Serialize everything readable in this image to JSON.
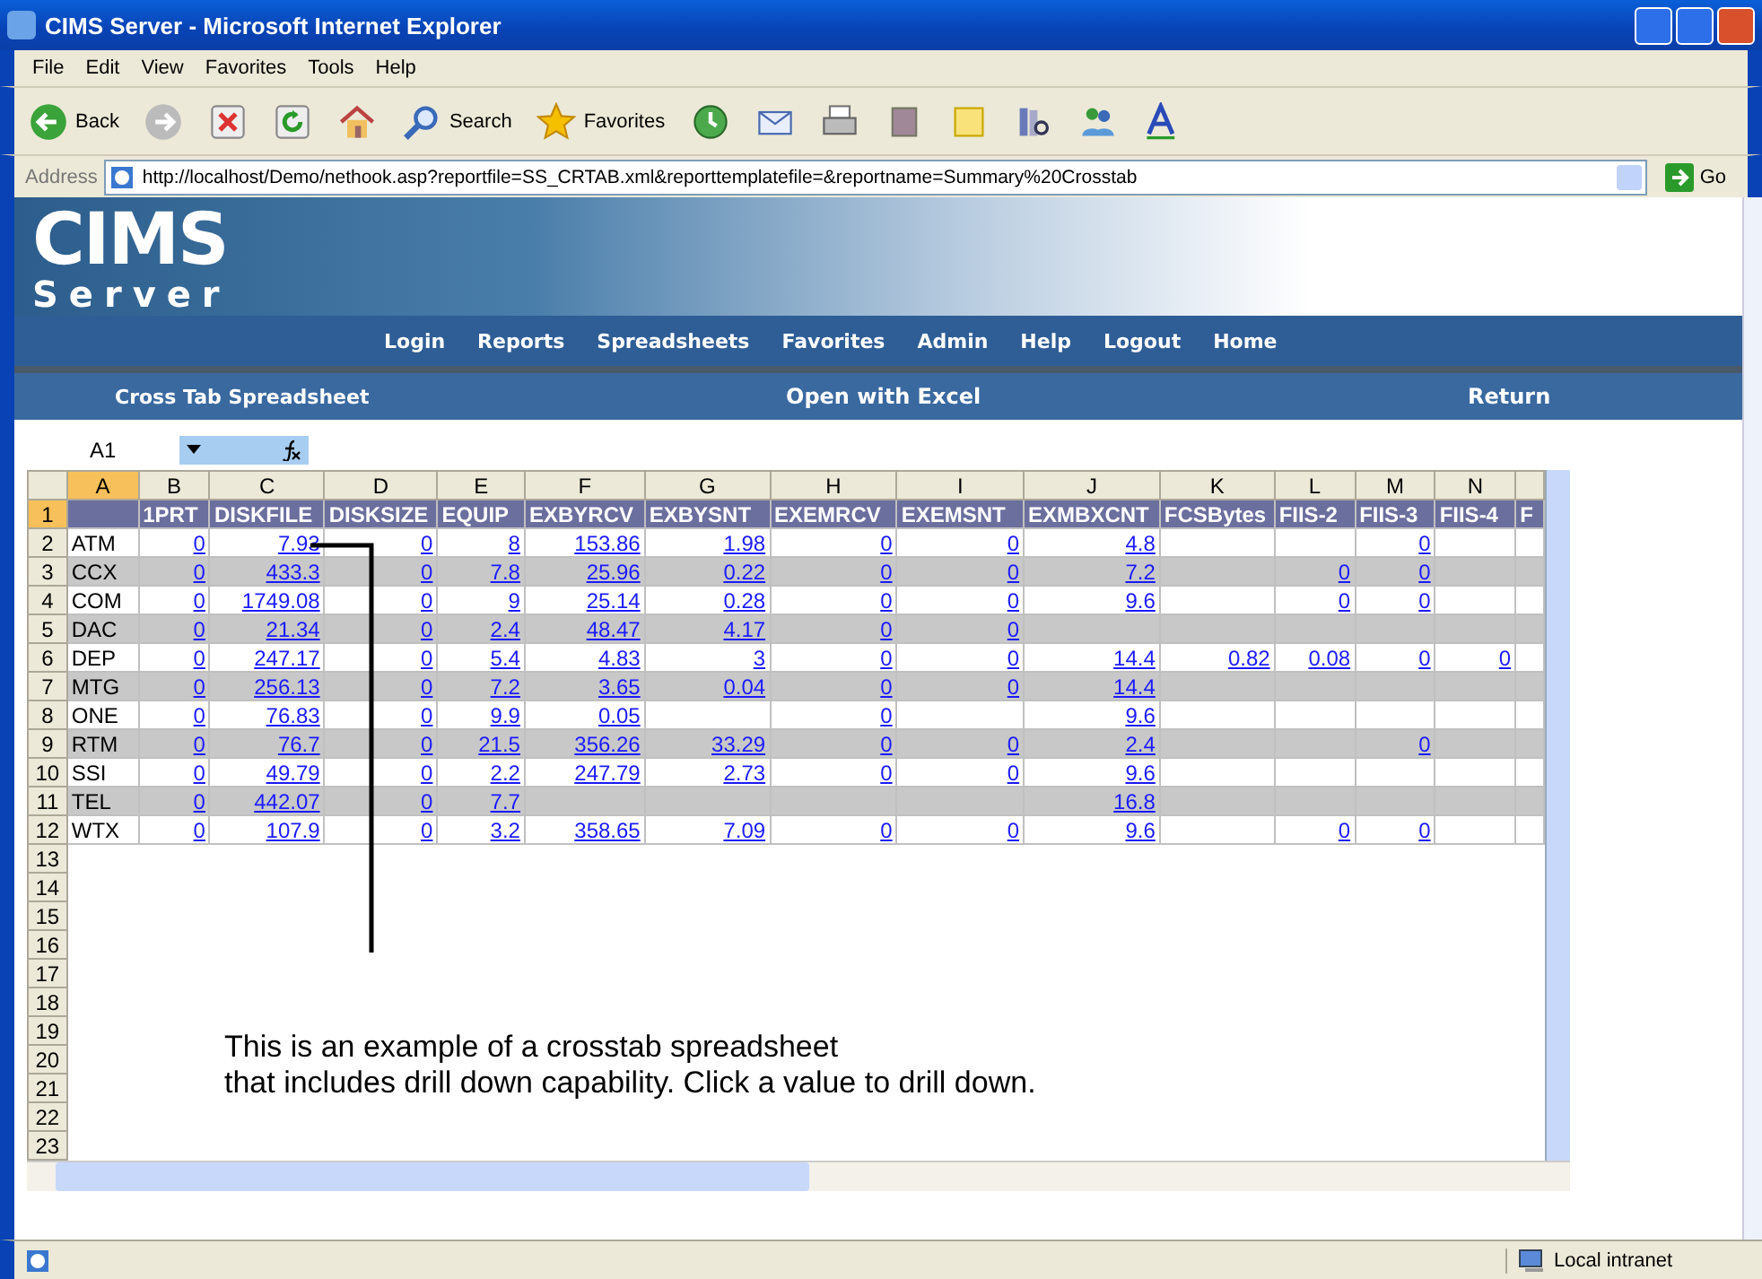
{
  "window": {
    "title": "CIMS Server - Microsoft Internet Explorer"
  },
  "menu": [
    "File",
    "Edit",
    "View",
    "Favorites",
    "Tools",
    "Help"
  ],
  "toolbar": [
    {
      "kind": "back",
      "label": "Back"
    },
    {
      "kind": "forward"
    },
    {
      "kind": "stop"
    },
    {
      "kind": "refresh"
    },
    {
      "kind": "home"
    },
    {
      "kind": "search",
      "label": "Search"
    },
    {
      "kind": "favorites",
      "label": "Favorites"
    },
    {
      "kind": "history"
    },
    {
      "kind": "mail"
    },
    {
      "kind": "print"
    },
    {
      "kind": "edit"
    },
    {
      "kind": "note"
    },
    {
      "kind": "research"
    },
    {
      "kind": "messenger"
    },
    {
      "kind": "font"
    }
  ],
  "address": {
    "label": "Address",
    "value": "http://localhost/Demo/nethook.asp?reportfile=SS_CRTAB.xml&reporttemplatefile=&reportname=Summary%20Crosstab",
    "go": "Go"
  },
  "banner": {
    "logo_title": "CIMS",
    "logo_subtitle": "Server",
    "nav": [
      "Login",
      "Reports",
      "Spreadsheets",
      "Favorites",
      "Admin",
      "Help",
      "Logout",
      "Home"
    ]
  },
  "subbar": {
    "title": "Cross Tab Spreadsheet",
    "open": "Open with Excel",
    "return": "Return"
  },
  "formula_bar": {
    "name_box": "A1"
  },
  "sheet": {
    "columns": [
      {
        "letter": "A",
        "selected": true
      },
      {
        "letter": "B",
        "selected": false
      },
      {
        "letter": "C",
        "selected": false
      },
      {
        "letter": "D",
        "selected": false
      },
      {
        "letter": "E",
        "selected": false
      },
      {
        "letter": "F",
        "selected": false
      },
      {
        "letter": "G",
        "selected": false
      },
      {
        "letter": "H",
        "selected": false
      },
      {
        "letter": "I",
        "selected": false
      },
      {
        "letter": "J",
        "selected": false
      },
      {
        "letter": "K",
        "selected": false
      },
      {
        "letter": "L",
        "selected": false
      },
      {
        "letter": "M",
        "selected": false
      },
      {
        "letter": "N",
        "selected": false
      }
    ],
    "row_numbers": [
      {
        "number": "1",
        "selected": true
      },
      {
        "number": "2",
        "selected": false
      },
      {
        "number": "3",
        "selected": false
      },
      {
        "number": "4",
        "selected": false
      },
      {
        "number": "5",
        "selected": false
      },
      {
        "number": "6",
        "selected": false
      },
      {
        "number": "7",
        "selected": false
      },
      {
        "number": "8",
        "selected": false
      },
      {
        "number": "9",
        "selected": false
      },
      {
        "number": "10",
        "selected": false
      },
      {
        "number": "11",
        "selected": false
      },
      {
        "number": "12",
        "selected": false
      },
      {
        "number": "13",
        "selected": false
      },
      {
        "number": "14",
        "selected": false
      },
      {
        "number": "15",
        "selected": false
      },
      {
        "number": "16",
        "selected": false
      },
      {
        "number": "17",
        "selected": false
      },
      {
        "number": "18",
        "selected": false
      },
      {
        "number": "19",
        "selected": false
      },
      {
        "number": "20",
        "selected": false
      },
      {
        "number": "21",
        "selected": false
      },
      {
        "number": "22",
        "selected": false
      },
      {
        "number": "23",
        "selected": false
      }
    ],
    "headers": [
      "1PRT",
      "DISKFILE",
      "DISKSIZE",
      "EQUIP",
      "EXBYRCV",
      "EXBYSNT",
      "EXEMRCV",
      "EXEMSNT",
      "EXMBXCNT",
      "FCSBytes",
      "FIIS-2",
      "FIIS-3",
      "FIIS-4",
      "F"
    ],
    "rows": [
      {
        "cells": [
          "ATM",
          "0",
          "7.93",
          "0",
          "8",
          "153.86",
          "1.98",
          "0",
          "0",
          "4.8",
          null,
          null,
          "0",
          null
        ]
      },
      {
        "cells": [
          "CCX",
          "0",
          "433.3",
          "0",
          "7.8",
          "25.96",
          "0.22",
          "0",
          "0",
          "7.2",
          null,
          "0",
          "0",
          null
        ]
      },
      {
        "cells": [
          "COM",
          "0",
          "1749.08",
          "0",
          "9",
          "25.14",
          "0.28",
          "0",
          "0",
          "9.6",
          null,
          "0",
          "0",
          null
        ]
      },
      {
        "cells": [
          "DAC",
          "0",
          "21.34",
          "0",
          "2.4",
          "48.47",
          "4.17",
          "0",
          "0",
          null,
          null,
          null,
          null,
          null
        ]
      },
      {
        "cells": [
          "DEP",
          "0",
          "247.17",
          "0",
          "5.4",
          "4.83",
          "3",
          "0",
          "0",
          "14.4",
          "0.82",
          "0.08",
          "0",
          "0"
        ]
      },
      {
        "cells": [
          "MTG",
          "0",
          "256.13",
          "0",
          "7.2",
          "3.65",
          "0.04",
          "0",
          "0",
          "14.4",
          null,
          null,
          null,
          null
        ]
      },
      {
        "cells": [
          "ONE",
          "0",
          "76.83",
          "0",
          "9.9",
          "0.05",
          null,
          "0",
          null,
          "9.6",
          null,
          null,
          null,
          null
        ]
      },
      {
        "cells": [
          "RTM",
          "0",
          "76.7",
          "0",
          "21.5",
          "356.26",
          "33.29",
          "0",
          "0",
          "2.4",
          null,
          null,
          "0",
          null
        ]
      },
      {
        "cells": [
          "SSI",
          "0",
          "49.79",
          "0",
          "2.2",
          "247.79",
          "2.73",
          "0",
          "0",
          "9.6",
          null,
          null,
          null,
          null
        ]
      },
      {
        "cells": [
          "TEL",
          "0",
          "442.07",
          "0",
          "7.7",
          null,
          null,
          null,
          null,
          "16.8",
          null,
          null,
          null,
          null
        ]
      },
      {
        "cells": [
          "WTX",
          "0",
          "107.9",
          "0",
          "3.2",
          "358.65",
          "7.09",
          "0",
          "0",
          "9.6",
          null,
          "0",
          "0",
          null
        ]
      }
    ]
  },
  "callout": [
    "This is an example of a crosstab spreadsheet",
    "that includes drill down capability. Click a value to drill down."
  ],
  "status_bar": {
    "zone": "Local intranet"
  }
}
